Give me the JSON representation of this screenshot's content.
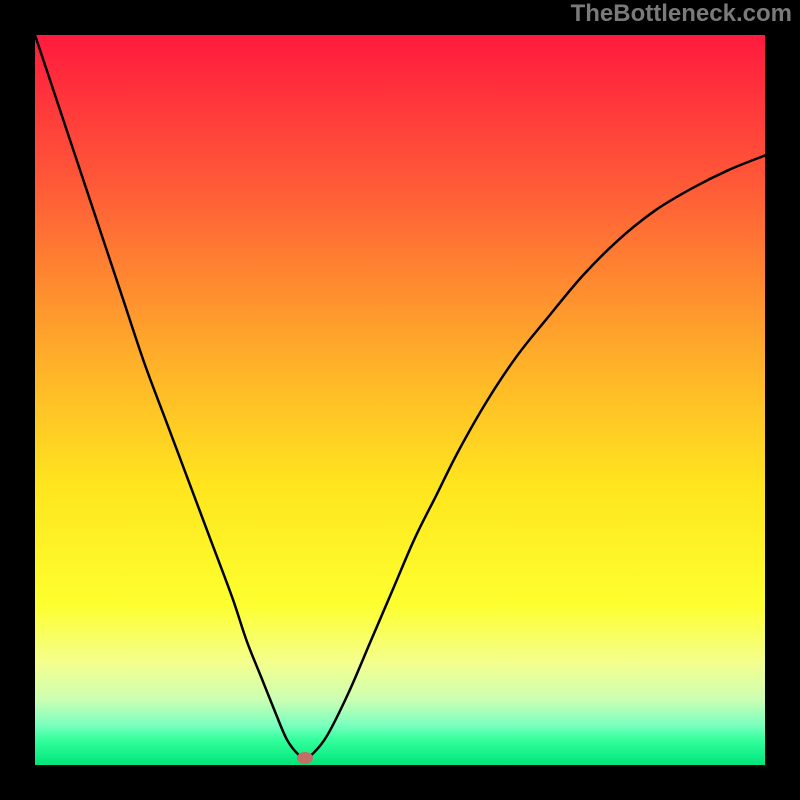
{
  "watermark": {
    "text": "TheBottleneck.com"
  },
  "chart_data": {
    "type": "line",
    "title": "",
    "xlabel": "",
    "ylabel": "",
    "xlim": [
      0,
      100
    ],
    "ylim": [
      0,
      100
    ],
    "legend": false,
    "grid": false,
    "background_gradient": {
      "type": "vertical",
      "stops": [
        {
          "pos": 0.0,
          "color": "#ff1a3e"
        },
        {
          "pos": 0.2,
          "color": "#ff5838"
        },
        {
          "pos": 0.45,
          "color": "#ffb129"
        },
        {
          "pos": 0.62,
          "color": "#ffe61e"
        },
        {
          "pos": 0.78,
          "color": "#fdff2e"
        },
        {
          "pos": 0.86,
          "color": "#f4ff8e"
        },
        {
          "pos": 0.91,
          "color": "#ccffb3"
        },
        {
          "pos": 0.945,
          "color": "#7bffbf"
        },
        {
          "pos": 0.965,
          "color": "#35ff9d"
        },
        {
          "pos": 1.0,
          "color": "#00e57a"
        }
      ]
    },
    "series": [
      {
        "name": "bottleneck-curve",
        "color": "#000000",
        "x": [
          0,
          3,
          6,
          9,
          12,
          15,
          18,
          21,
          24,
          27,
          29,
          31,
          33,
          34.5,
          36,
          37,
          38,
          40,
          43,
          46,
          49,
          52,
          55,
          58,
          62,
          66,
          70,
          75,
          80,
          85,
          90,
          95,
          100
        ],
        "y": [
          100,
          91,
          82,
          73,
          64,
          55,
          47,
          39,
          31,
          23,
          17,
          12,
          7,
          3.5,
          1.5,
          1.0,
          1.5,
          4,
          10,
          17,
          24,
          31,
          37,
          43,
          50,
          56,
          61,
          67,
          72,
          76,
          79,
          81.5,
          83.5
        ]
      }
    ],
    "marker": {
      "name": "selected-point",
      "x": 37,
      "y": 1.0,
      "color": "#c27066"
    }
  }
}
